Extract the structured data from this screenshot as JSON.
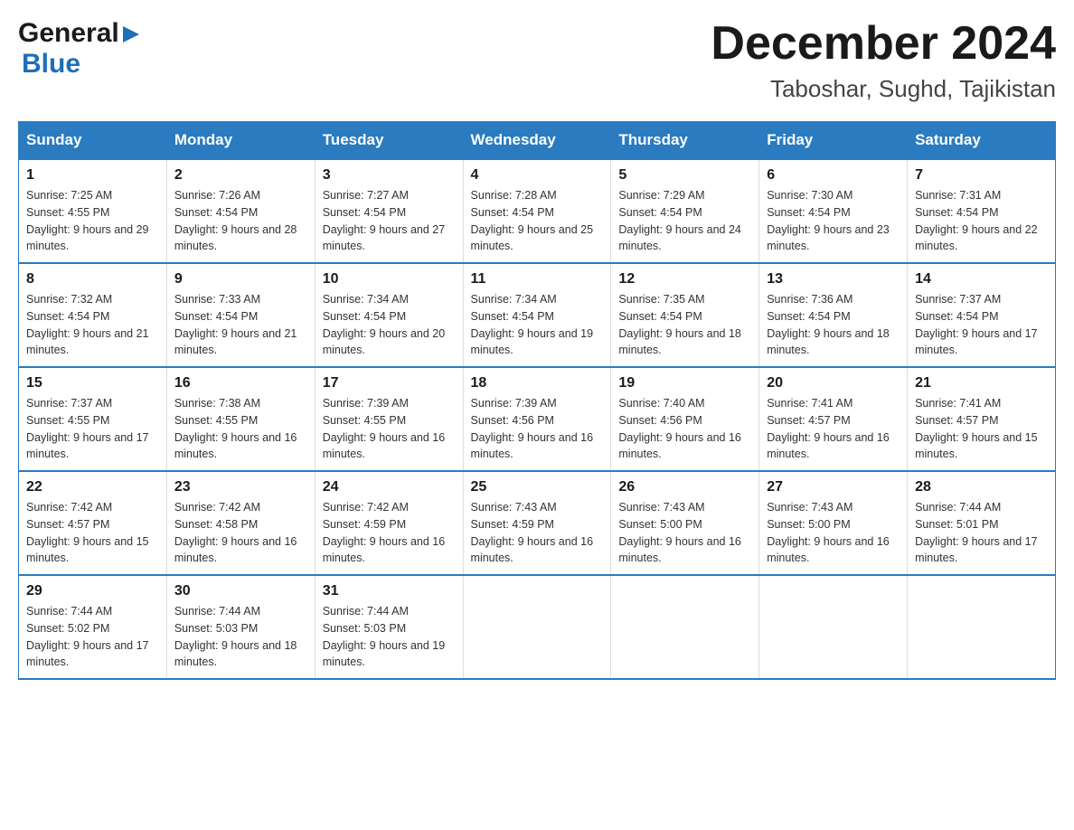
{
  "header": {
    "logo_general": "General",
    "logo_blue": "Blue",
    "month_title": "December 2024",
    "location": "Taboshar, Sughd, Tajikistan"
  },
  "weekdays": [
    "Sunday",
    "Monday",
    "Tuesday",
    "Wednesday",
    "Thursday",
    "Friday",
    "Saturday"
  ],
  "weeks": [
    [
      {
        "day": "1",
        "sunrise": "7:25 AM",
        "sunset": "4:55 PM",
        "daylight": "9 hours and 29 minutes."
      },
      {
        "day": "2",
        "sunrise": "7:26 AM",
        "sunset": "4:54 PM",
        "daylight": "9 hours and 28 minutes."
      },
      {
        "day": "3",
        "sunrise": "7:27 AM",
        "sunset": "4:54 PM",
        "daylight": "9 hours and 27 minutes."
      },
      {
        "day": "4",
        "sunrise": "7:28 AM",
        "sunset": "4:54 PM",
        "daylight": "9 hours and 25 minutes."
      },
      {
        "day": "5",
        "sunrise": "7:29 AM",
        "sunset": "4:54 PM",
        "daylight": "9 hours and 24 minutes."
      },
      {
        "day": "6",
        "sunrise": "7:30 AM",
        "sunset": "4:54 PM",
        "daylight": "9 hours and 23 minutes."
      },
      {
        "day": "7",
        "sunrise": "7:31 AM",
        "sunset": "4:54 PM",
        "daylight": "9 hours and 22 minutes."
      }
    ],
    [
      {
        "day": "8",
        "sunrise": "7:32 AM",
        "sunset": "4:54 PM",
        "daylight": "9 hours and 21 minutes."
      },
      {
        "day": "9",
        "sunrise": "7:33 AM",
        "sunset": "4:54 PM",
        "daylight": "9 hours and 21 minutes."
      },
      {
        "day": "10",
        "sunrise": "7:34 AM",
        "sunset": "4:54 PM",
        "daylight": "9 hours and 20 minutes."
      },
      {
        "day": "11",
        "sunrise": "7:34 AM",
        "sunset": "4:54 PM",
        "daylight": "9 hours and 19 minutes."
      },
      {
        "day": "12",
        "sunrise": "7:35 AM",
        "sunset": "4:54 PM",
        "daylight": "9 hours and 18 minutes."
      },
      {
        "day": "13",
        "sunrise": "7:36 AM",
        "sunset": "4:54 PM",
        "daylight": "9 hours and 18 minutes."
      },
      {
        "day": "14",
        "sunrise": "7:37 AM",
        "sunset": "4:54 PM",
        "daylight": "9 hours and 17 minutes."
      }
    ],
    [
      {
        "day": "15",
        "sunrise": "7:37 AM",
        "sunset": "4:55 PM",
        "daylight": "9 hours and 17 minutes."
      },
      {
        "day": "16",
        "sunrise": "7:38 AM",
        "sunset": "4:55 PM",
        "daylight": "9 hours and 16 minutes."
      },
      {
        "day": "17",
        "sunrise": "7:39 AM",
        "sunset": "4:55 PM",
        "daylight": "9 hours and 16 minutes."
      },
      {
        "day": "18",
        "sunrise": "7:39 AM",
        "sunset": "4:56 PM",
        "daylight": "9 hours and 16 minutes."
      },
      {
        "day": "19",
        "sunrise": "7:40 AM",
        "sunset": "4:56 PM",
        "daylight": "9 hours and 16 minutes."
      },
      {
        "day": "20",
        "sunrise": "7:41 AM",
        "sunset": "4:57 PM",
        "daylight": "9 hours and 16 minutes."
      },
      {
        "day": "21",
        "sunrise": "7:41 AM",
        "sunset": "4:57 PM",
        "daylight": "9 hours and 15 minutes."
      }
    ],
    [
      {
        "day": "22",
        "sunrise": "7:42 AM",
        "sunset": "4:57 PM",
        "daylight": "9 hours and 15 minutes."
      },
      {
        "day": "23",
        "sunrise": "7:42 AM",
        "sunset": "4:58 PM",
        "daylight": "9 hours and 16 minutes."
      },
      {
        "day": "24",
        "sunrise": "7:42 AM",
        "sunset": "4:59 PM",
        "daylight": "9 hours and 16 minutes."
      },
      {
        "day": "25",
        "sunrise": "7:43 AM",
        "sunset": "4:59 PM",
        "daylight": "9 hours and 16 minutes."
      },
      {
        "day": "26",
        "sunrise": "7:43 AM",
        "sunset": "5:00 PM",
        "daylight": "9 hours and 16 minutes."
      },
      {
        "day": "27",
        "sunrise": "7:43 AM",
        "sunset": "5:00 PM",
        "daylight": "9 hours and 16 minutes."
      },
      {
        "day": "28",
        "sunrise": "7:44 AM",
        "sunset": "5:01 PM",
        "daylight": "9 hours and 17 minutes."
      }
    ],
    [
      {
        "day": "29",
        "sunrise": "7:44 AM",
        "sunset": "5:02 PM",
        "daylight": "9 hours and 17 minutes."
      },
      {
        "day": "30",
        "sunrise": "7:44 AM",
        "sunset": "5:03 PM",
        "daylight": "9 hours and 18 minutes."
      },
      {
        "day": "31",
        "sunrise": "7:44 AM",
        "sunset": "5:03 PM",
        "daylight": "9 hours and 19 minutes."
      },
      null,
      null,
      null,
      null
    ]
  ]
}
